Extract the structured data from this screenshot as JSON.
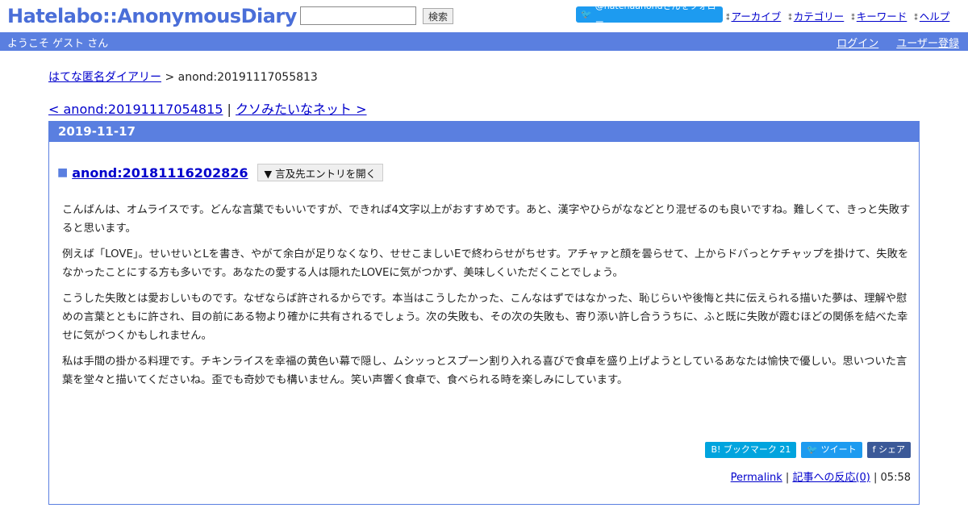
{
  "header": {
    "logo": "Hatelabo::AnonymousDiary",
    "search_placeholder": "",
    "search_label": "検索",
    "follow_label": "@hatenaanondさんをフォロー",
    "nav": [
      "アーカイブ",
      "カテゴリー",
      "キーワード",
      "ヘルプ"
    ]
  },
  "welcome": {
    "text": "ようこそ ゲスト さん",
    "login": "ログイン",
    "register": "ユーザー登録"
  },
  "breadcrumb": {
    "home": "はてな匿名ダイアリー",
    "sep": ">",
    "current": "anond:20191117055813"
  },
  "pager": {
    "prev": "< anond:20191117054815",
    "sep": "|",
    "next": "クソみたいなネット >"
  },
  "day": {
    "date": "2019-11-17",
    "entry_title": "anond:20181116202826",
    "expand_label": "▼ 言及先エントリを開く",
    "paragraphs": [
      "こんばんは、オムライスです。どんな言葉でもいいですが、できれば4文字以上がおすすめです。あと、漢字やひらがななどとり混ぜるのも良いですね。難しくて、きっと失敗すると思います。",
      "例えば「LOVE」。せいせいとLを書き、やがて余白が足りなくなり、せせこましいEで終わらせがちせす。アチャァと顔を曇らせて、上からドバっとケチャップを掛けて、失敗をなかったことにする方も多いです。あなたの愛する人は隠れたLOVEに気がつかず、美味しくいただくことでしょう。",
      "こうした失敗とは愛おしいものです。なぜならば許されるからです。本当はこうしたかった、こんなはずではなかった、恥じらいや後悔と共に伝えられる描いた夢は、理解や慰めの言葉とともに許され、目の前にある物より確かに共有されるでしょう。次の失敗も、その次の失敗も、寄り添い許し合ううちに、ふと既に失敗が霞むほどの関係を結べた幸せに気がつくかもしれません。",
      "私は手間の掛かる料理です。チキンライスを幸福の黄色い幕で隠し、ムシッっとスプーン割り入れる喜びで食卓を盛り上げようとしているあなたは愉快で優しい。思いついた言葉を堂々と描いてくださいね。歪でも奇妙でも構いません。笑い声響く食卓で、食べられる時を楽しみにしています。"
    ],
    "share": {
      "bookmark": "B! ブックマーク",
      "bookmark_count": "21",
      "tweet": "ツイート",
      "facebook": "シェア"
    },
    "footer": {
      "permalink": "Permalink",
      "reactions": "記事への反応(0)",
      "time": "05:58",
      "sep": "|"
    }
  }
}
